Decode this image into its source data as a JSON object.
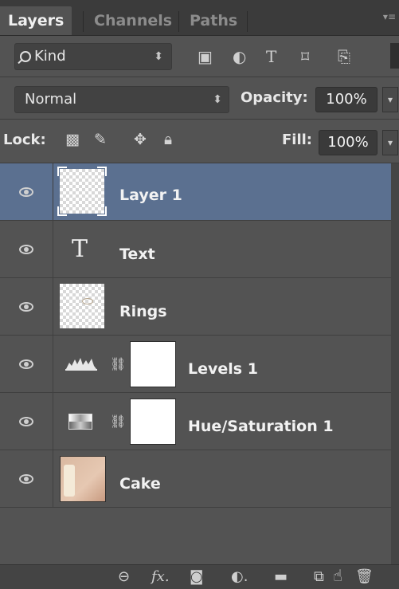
{
  "tabs": [
    "Layers",
    "Channels",
    "Paths"
  ],
  "filter": {
    "kind": "Kind"
  },
  "blend": {
    "mode": "Normal",
    "opacity_label": "Opacity:",
    "opacity": "100%"
  },
  "lock": {
    "label": "Lock:",
    "fill_label": "Fill:",
    "fill": "100%"
  },
  "layers": [
    {
      "name": "Layer 1",
      "selected": true
    },
    {
      "name": "Text"
    },
    {
      "name": "Rings"
    },
    {
      "name": "Levels 1"
    },
    {
      "name": "Hue/Saturation 1"
    },
    {
      "name": "Cake"
    }
  ],
  "icons": {
    "filter": [
      "image-filter-icon",
      "adjustment-filter-icon",
      "type-filter-icon",
      "shape-filter-icon",
      "smart-object-filter-icon"
    ],
    "lock": [
      "lock-transparent-icon",
      "lock-brush-icon",
      "lock-position-icon",
      "lock-all-icon"
    ],
    "bottom": [
      "link-layers-icon",
      "fx-icon",
      "add-mask-icon",
      "new-adjustment-icon",
      "new-group-icon",
      "new-layer-icon",
      "trash-icon"
    ]
  },
  "colors": {
    "panel": "#535353",
    "selected": "#5b7090",
    "tabbar": "#3b3b3b"
  }
}
